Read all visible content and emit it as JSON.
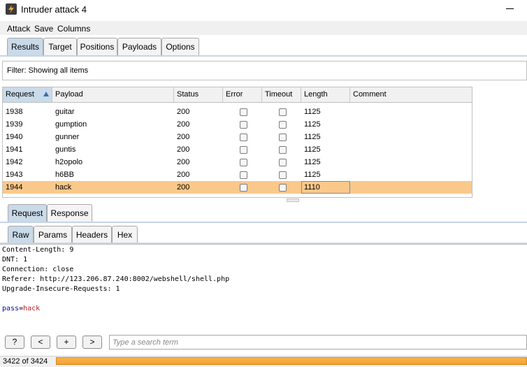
{
  "window": {
    "title": "Intruder attack 4"
  },
  "menu": [
    "Attack",
    "Save",
    "Columns"
  ],
  "main_tabs": [
    "Results",
    "Target",
    "Positions",
    "Payloads",
    "Options"
  ],
  "filter": {
    "text": "Filter: Showing all items"
  },
  "table": {
    "columns": [
      "Request",
      "Payload",
      "Status",
      "Error",
      "Timeout",
      "Length",
      "Comment"
    ],
    "sorted_column": "Request",
    "rows": [
      {
        "request": "1938",
        "payload": "guitar",
        "status": "200",
        "length": "1125"
      },
      {
        "request": "1939",
        "payload": "gumption",
        "status": "200",
        "length": "1125"
      },
      {
        "request": "1940",
        "payload": "gunner",
        "status": "200",
        "length": "1125"
      },
      {
        "request": "1941",
        "payload": "guntis",
        "status": "200",
        "length": "1125"
      },
      {
        "request": "1942",
        "payload": "h2opolo",
        "status": "200",
        "length": "1125"
      },
      {
        "request": "1943",
        "payload": "h6BB",
        "status": "200",
        "length": "1125"
      },
      {
        "request": "1944",
        "payload": "hack",
        "status": "200",
        "length": "1110"
      }
    ],
    "selected_row": 6,
    "selected_color": "#fac88a"
  },
  "detail_tabs": [
    "Request",
    "Response"
  ],
  "view_tabs": [
    "Raw",
    "Params",
    "Headers",
    "Hex"
  ],
  "editor": {
    "lines": [
      "Content-Length: 9",
      "DNT: 1",
      "Connection: close",
      "Referer: http://123.206.87.240:8002/webshell/shell.php",
      "Upgrade-Insecure-Requests: 1"
    ],
    "body_key": "pass",
    "body_eq": "=",
    "body_value": "hack"
  },
  "toolbar": {
    "help": "?",
    "prev": "<",
    "add": "+",
    "next": ">"
  },
  "search": {
    "placeholder": "Type a search term"
  },
  "status": {
    "text": "3422 of 3424",
    "progress": 0.9994
  }
}
